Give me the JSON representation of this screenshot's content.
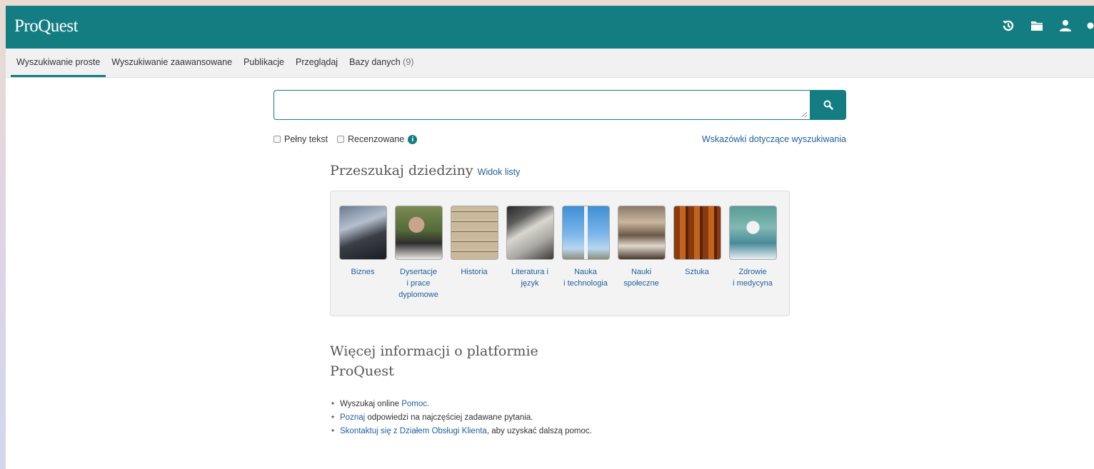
{
  "app": {
    "logo": "ProQuest"
  },
  "header": {
    "icons": [
      "history-icon",
      "folder-icon",
      "user-icon",
      "help-icon"
    ]
  },
  "nav": {
    "items": [
      {
        "label": "Wyszukiwanie proste",
        "active": true
      },
      {
        "label": "Wyszukiwanie zaawansowane"
      },
      {
        "label": "Publikacje"
      },
      {
        "label": "Przeglądaj"
      },
      {
        "label": "Bazy danych",
        "count": "(9)"
      }
    ]
  },
  "search": {
    "value": "",
    "placeholder": "",
    "button_icon": "search-icon"
  },
  "options": {
    "full_text": "Pełny tekst",
    "peer_reviewed": "Recenzowane",
    "info_icon": "i",
    "tips": "Wskazówki dotyczące wyszukiwania"
  },
  "subjects": {
    "title": "Przeszukaj dziedziny",
    "list_view": "Widok listy",
    "items": [
      {
        "l1": "Biznes",
        "l2": "",
        "l3": ""
      },
      {
        "l1": "Dysertacje",
        "l2": "i prace",
        "l3": "dyplomowe"
      },
      {
        "l1": "Historia",
        "l2": "",
        "l3": ""
      },
      {
        "l1": "Literatura i język",
        "l2": "",
        "l3": ""
      },
      {
        "l1": "Nauka",
        "l2": "i technologia",
        "l3": ""
      },
      {
        "l1": "Nauki społeczne",
        "l2": "",
        "l3": ""
      },
      {
        "l1": "Sztuka",
        "l2": "",
        "l3": ""
      },
      {
        "l1": "Zdrowie",
        "l2": "i medycyna",
        "l3": ""
      }
    ]
  },
  "more": {
    "title_line1": "Więcej informacji o platformie",
    "title_line2": "ProQuest",
    "items": [
      {
        "pre": "Wyszukaj online ",
        "link": "Pomoc.",
        "post": ""
      },
      {
        "pre": "",
        "link": "Poznaj",
        "post": " odpowiedzi na najczęściej zadawane pytania."
      },
      {
        "pre": "",
        "link": "Skontaktuj się z Działem Obsługi Klienta",
        "post": ", aby uzyskać dalszą pomoc."
      }
    ]
  },
  "colors": {
    "brand": "#137d82",
    "link": "#1f5f9e"
  }
}
